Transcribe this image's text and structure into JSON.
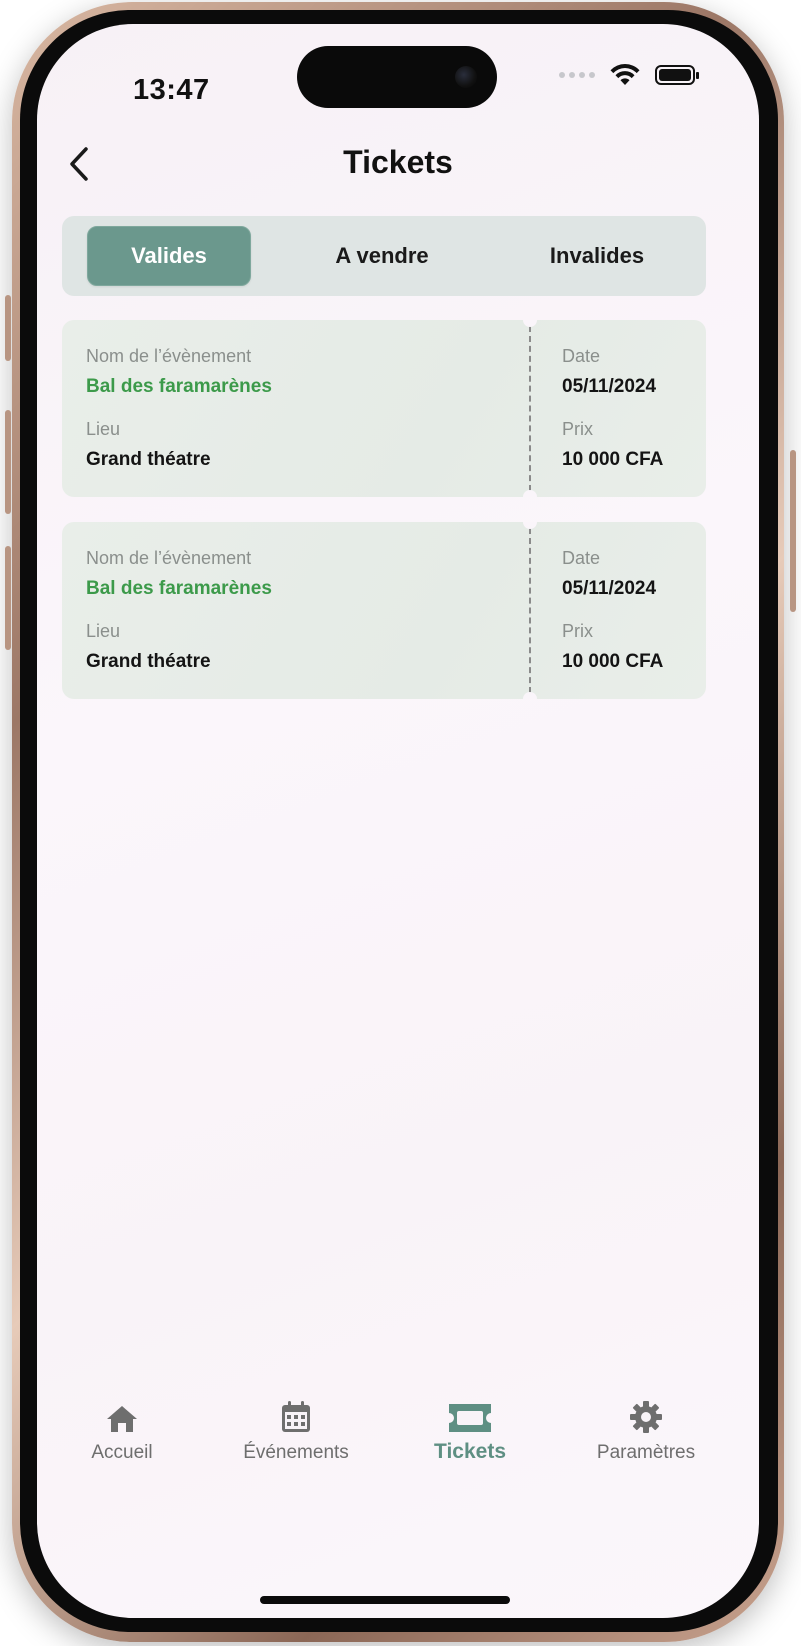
{
  "status_bar": {
    "time": "13:47"
  },
  "header": {
    "title": "Tickets"
  },
  "segments": [
    {
      "label": "Valides",
      "active": true
    },
    {
      "label": "A vendre",
      "active": false
    },
    {
      "label": "Invalides",
      "active": false
    }
  ],
  "tickets": [
    {
      "event_label": "Nom de l’évènement",
      "event_name": "Bal des faramarènes",
      "place_label": "Lieu",
      "place": "Grand théatre",
      "date_label": "Date",
      "date": "05/11/2024",
      "price_label": "Prix",
      "price": "10 000 CFA"
    },
    {
      "event_label": "Nom de l’évènement",
      "event_name": "Bal des faramarènes",
      "place_label": "Lieu",
      "place": "Grand théatre",
      "date_label": "Date",
      "date": "05/11/2024",
      "price_label": "Prix",
      "price": "10 000 CFA"
    }
  ],
  "tab_bar": {
    "items": [
      {
        "label": "Accueil",
        "icon": "home-icon"
      },
      {
        "label": "Événements",
        "icon": "calendar-icon"
      },
      {
        "label": "Tickets",
        "icon": "ticket-icon",
        "active": true
      },
      {
        "label": "Paramètres",
        "icon": "gear-icon"
      }
    ]
  },
  "colors": {
    "accent": "#6b988d",
    "event_name": "#3c9a4a",
    "active_tab": "#5e8f83"
  }
}
